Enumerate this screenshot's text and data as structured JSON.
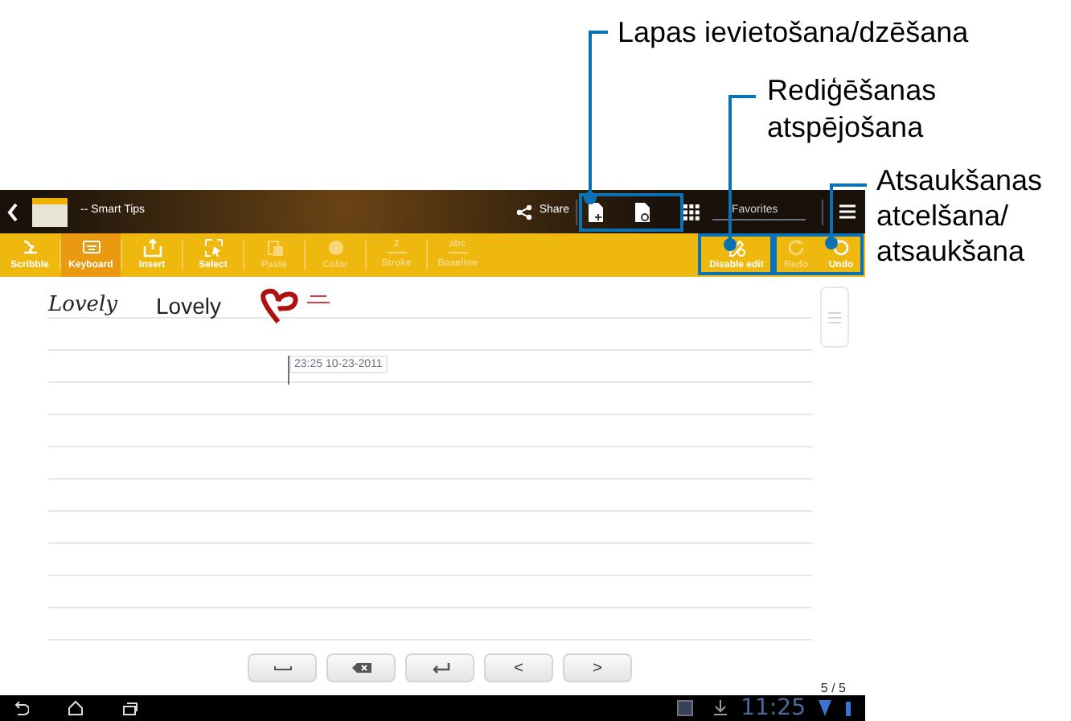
{
  "callouts": [
    {
      "text": "Lapas ievietošana/dzēšana"
    },
    {
      "lines": [
        "Rediģēšanas",
        "atspējošana"
      ]
    },
    {
      "lines": [
        "Atsaukšanas",
        "atcelšana/",
        "atsaukšana"
      ]
    }
  ],
  "app_bar": {
    "title": "-- Smart Tips",
    "share": "Share",
    "favorites": "Favorites"
  },
  "toolbar": [
    {
      "label": "Scribble",
      "kind": "scribble",
      "selected": false,
      "disabled": false
    },
    {
      "label": "Keyboard",
      "kind": "keyboard",
      "selected": true,
      "disabled": false
    },
    {
      "label": "Insert",
      "kind": "insert",
      "selected": false,
      "disabled": false
    },
    {
      "label": "Select",
      "kind": "select",
      "selected": false,
      "disabled": false
    },
    {
      "label": "Paste",
      "kind": "paste",
      "selected": false,
      "disabled": true
    },
    {
      "label": "Color",
      "kind": "color",
      "selected": false,
      "disabled": true
    },
    {
      "label": "Stroke",
      "kind": "stroke",
      "glyph": "2",
      "selected": false,
      "disabled": true
    },
    {
      "label": "Baseline",
      "kind": "baseline",
      "glyph": "abc",
      "selected": false,
      "disabled": true
    }
  ],
  "toolbar_right": [
    {
      "label": "Disable edit",
      "kind": "edit",
      "disabled": false
    },
    {
      "label": "Redo",
      "kind": "redo",
      "disabled": true
    },
    {
      "label": "Undo",
      "kind": "undo",
      "disabled": false
    }
  ],
  "note": {
    "handwriting": "Lovely",
    "typed": "Lovely",
    "timestamp": "23:25 10-23-2011",
    "page": "5 / 5"
  },
  "keys": [
    {
      "kind": "space"
    },
    {
      "kind": "backspace"
    },
    {
      "kind": "enter"
    },
    {
      "kind": "char",
      "label": "<"
    },
    {
      "kind": "char",
      "label": ">"
    }
  ],
  "status_bar": {
    "time": "11:25"
  }
}
